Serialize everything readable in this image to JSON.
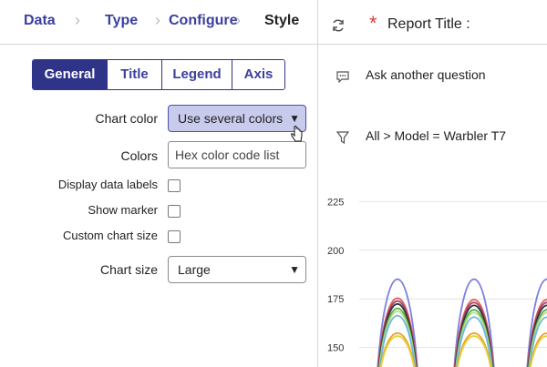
{
  "wizard": {
    "steps": [
      "Data",
      "Type",
      "Configure",
      "Style"
    ],
    "active_step": "Style"
  },
  "tabs": [
    {
      "label": "General",
      "active": true
    },
    {
      "label": "Title",
      "active": false
    },
    {
      "label": "Legend",
      "active": false
    },
    {
      "label": "Axis",
      "active": false
    }
  ],
  "form": {
    "chart_color_label": "Chart color",
    "chart_color_value": "Use several colors",
    "colors_label": "Colors",
    "colors_placeholder": "Hex color code list",
    "display_data_labels_label": "Display data labels",
    "show_marker_label": "Show marker",
    "custom_chart_size_label": "Custom chart size",
    "chart_size_label": "Chart size",
    "chart_size_value": "Large"
  },
  "report": {
    "title": "Report Title :",
    "ask_label": "Ask another question",
    "filter_text": "All  >  Model = Warbler T7"
  },
  "colors": {
    "accent": "#2f3488",
    "required_star": "#e53935"
  },
  "chart_data": {
    "type": "line",
    "y_ticks": [
      225,
      200,
      175,
      150
    ],
    "ylim": [
      140,
      235
    ],
    "grid": true,
    "series": [
      {
        "color": "#7c7fe0",
        "values": [
          198,
          198
        ]
      },
      {
        "color": "#e05a5a",
        "values": [
          185,
          184
        ]
      },
      {
        "color": "#a04070",
        "values": [
          183,
          182
        ]
      },
      {
        "color": "#333333",
        "values": [
          181,
          180
        ]
      },
      {
        "color": "#4caf50",
        "values": [
          178,
          177
        ]
      },
      {
        "color": "#b6e07a",
        "values": [
          176,
          175
        ]
      },
      {
        "color": "#6fb6e8",
        "values": [
          173,
          172
        ]
      },
      {
        "color": "#e8a020",
        "values": [
          161,
          161
        ]
      },
      {
        "color": "#e8d040",
        "values": [
          159,
          159
        ]
      }
    ]
  }
}
